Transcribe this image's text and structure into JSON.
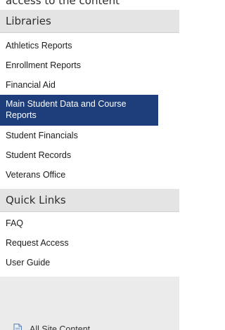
{
  "partial_top_text": "access to the content",
  "libraries": {
    "heading": "Libraries",
    "items": [
      {
        "label": "Athletics Reports"
      },
      {
        "label": "Enrollment Reports"
      },
      {
        "label": "Financial Aid"
      },
      {
        "label": "Main Student Data and Course Reports"
      },
      {
        "label": "Student Financials"
      },
      {
        "label": "Student Records"
      },
      {
        "label": "Veterans Office"
      }
    ],
    "selected_label": "Main Student Data and Course Reports"
  },
  "quick_links": {
    "heading": "Quick Links",
    "items": [
      {
        "label": "FAQ"
      },
      {
        "label": "Request Access"
      },
      {
        "label": "User Guide"
      }
    ]
  },
  "all_site_content": {
    "label": "All Site Content",
    "icon": "document-icon"
  },
  "colors": {
    "selected_background": "#1d3d7b",
    "panel_background": "#ebebeb",
    "header_background": "#e4e4e4"
  }
}
